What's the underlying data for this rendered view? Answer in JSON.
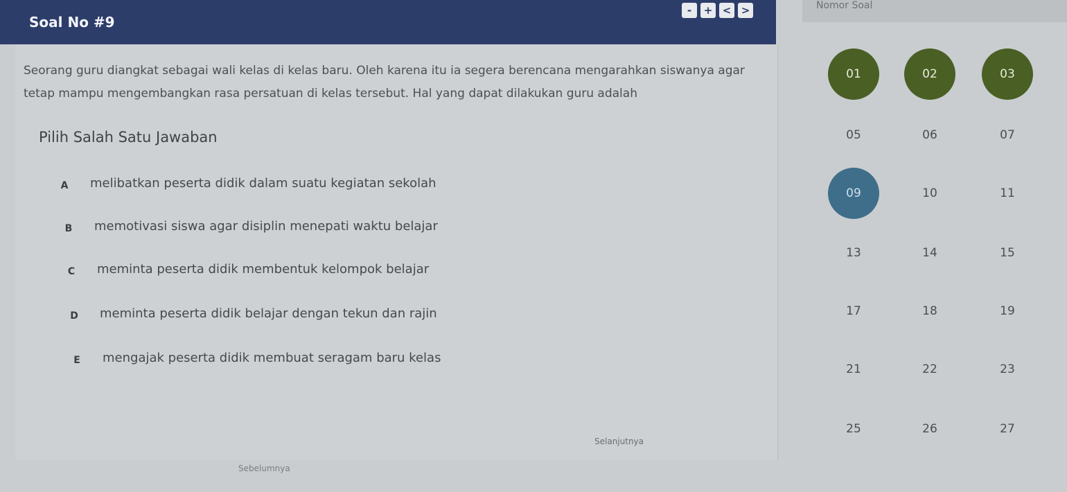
{
  "header": {
    "title": "Soal No #9",
    "controls": [
      "-",
      "+",
      "<",
      ">"
    ],
    "nav_title": "Nomor Soal"
  },
  "question": {
    "text_line1": "Seorang guru diangkat sebagai wali kelas di kelas baru. Oleh karena itu ia segera berencana mengarahkan siswanya agar",
    "text_line2": "tetap mampu mengembangkan rasa persatuan di kelas tersebut. Hal yang dapat dilakukan guru adalah",
    "instruction": "Pilih Salah Satu Jawaban",
    "options": [
      {
        "letter": "A",
        "text": "melibatkan peserta didik dalam suatu kegiatan sekolah"
      },
      {
        "letter": "B",
        "text": "memotivasi siswa agar disiplin menepati waktu belajar"
      },
      {
        "letter": "C",
        "text": "meminta peserta didik membentuk kelompok belajar"
      },
      {
        "letter": "D",
        "text": "meminta peserta didik belajar dengan tekun dan rajin"
      },
      {
        "letter": "E",
        "text": "mengajak peserta didik membuat seragam baru kelas"
      }
    ]
  },
  "buttons": {
    "next": "Selanjutnya",
    "prev": "Sebelumnya"
  },
  "numbers": [
    {
      "n": "01",
      "state": "answered"
    },
    {
      "n": "02",
      "state": "answered"
    },
    {
      "n": "03",
      "state": "answered"
    },
    {
      "n": "05",
      "state": "none"
    },
    {
      "n": "06",
      "state": "none"
    },
    {
      "n": "07",
      "state": "none"
    },
    {
      "n": "09",
      "state": "current"
    },
    {
      "n": "10",
      "state": "none"
    },
    {
      "n": "11",
      "state": "none"
    },
    {
      "n": "13",
      "state": "none"
    },
    {
      "n": "14",
      "state": "none"
    },
    {
      "n": "15",
      "state": "none"
    },
    {
      "n": "17",
      "state": "none"
    },
    {
      "n": "18",
      "state": "none"
    },
    {
      "n": "19",
      "state": "none"
    },
    {
      "n": "21",
      "state": "none"
    },
    {
      "n": "22",
      "state": "none"
    },
    {
      "n": "23",
      "state": "none"
    },
    {
      "n": "25",
      "state": "none"
    },
    {
      "n": "26",
      "state": "none"
    },
    {
      "n": "27",
      "state": "none"
    }
  ],
  "colors": {
    "header": "#2d3d6a",
    "answered": "#4a5f24",
    "current": "#3e6e8a"
  }
}
